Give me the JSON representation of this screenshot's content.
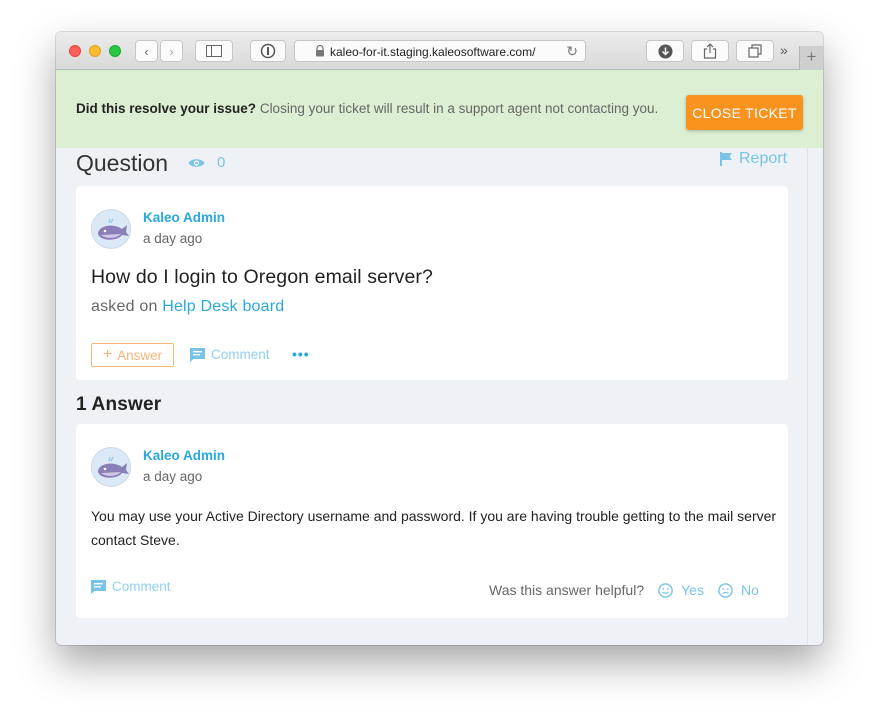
{
  "browser": {
    "url": "kaleo-for-it.staging.kaleosoftware.com/"
  },
  "banner": {
    "question_bold": "Did this resolve your issue?",
    "message": " Closing your ticket will result in a support agent not contacting you.",
    "close_button": "CLOSE TICKET",
    "color": "#dcefd3",
    "button_color": "#f7931e"
  },
  "question_section": {
    "heading": "Question",
    "view_count": "0",
    "report_label": "Report"
  },
  "question": {
    "author": "Kaleo Admin",
    "time": "a day ago",
    "title": "How do I login to Oregon email server?",
    "asked_prefix": "asked on",
    "board": "Help Desk board",
    "answer_button": "Answer",
    "comment_button": "Comment",
    "more_button": "•••"
  },
  "answers_heading": "1 Answer",
  "answer": {
    "author": "Kaleo Admin",
    "time": "a day ago",
    "body": "You may use your Active Directory username and password. If you are having trouble getting to the mail server contact Steve.",
    "comment_button": "Comment",
    "helpful_prompt": "Was this answer helpful?",
    "yes_label": "Yes",
    "no_label": "No"
  }
}
